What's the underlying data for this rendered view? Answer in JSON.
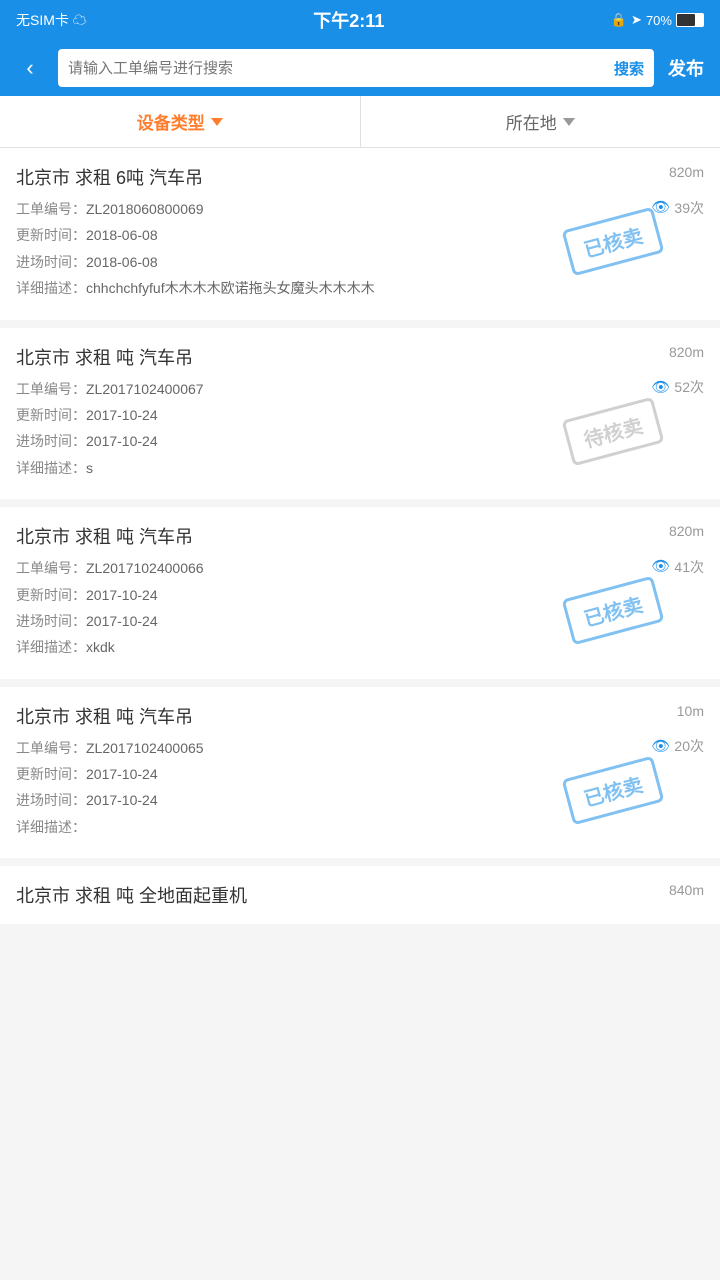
{
  "statusBar": {
    "left": "无SIM卡 ☁",
    "center": "下午2:11",
    "right": "70%"
  },
  "nav": {
    "back": "‹",
    "searchPlaceholder": "请输入工单编号进行搜索",
    "searchBtn": "搜索",
    "publishBtn": "发布"
  },
  "filter": {
    "deviceType": "设备类型",
    "location": "所在地"
  },
  "items": [
    {
      "title": "北京市 求租 6吨 汽车吊",
      "distance": "820m",
      "orderNo": "ZL2018060800069",
      "views": "39次",
      "updateTime": "2018-06-08",
      "enterTime": "2018-06-08",
      "desc": "chhchchfyfuf木木木木欧诺拖头女魔头木木木木",
      "stamp": "已核卖",
      "stampType": "sold",
      "stampTop": "80"
    },
    {
      "title": "北京市 求租 吨 汽车吊",
      "distance": "820m",
      "orderNo": "ZL2017102400067",
      "views": "52次",
      "updateTime": "2017-10-24",
      "enterTime": "2017-10-24",
      "desc": "s",
      "stamp": "待核卖",
      "stampType": "pending",
      "stampTop": "80"
    },
    {
      "title": "北京市 求租 吨 汽车吊",
      "distance": "820m",
      "orderNo": "ZL2017102400066",
      "views": "41次",
      "updateTime": "2017-10-24",
      "enterTime": "2017-10-24",
      "desc": "xkdk",
      "stamp": "已核卖",
      "stampType": "sold",
      "stampTop": "80"
    },
    {
      "title": "北京市 求租 吨 汽车吊",
      "distance": "10m",
      "orderNo": "ZL2017102400065",
      "views": "20次",
      "updateTime": "2017-10-24",
      "enterTime": "2017-10-24",
      "desc": "",
      "stamp": "已核卖",
      "stampType": "sold",
      "stampTop": "80"
    }
  ],
  "lastItem": {
    "title": "北京市 求租 吨 全地面起重机",
    "distance": "840m"
  },
  "labels": {
    "orderNo": "工单编号：",
    "views": "次",
    "updateTime": "更新时间：",
    "enterTime": "进场时间：",
    "desc": "详细描述："
  }
}
